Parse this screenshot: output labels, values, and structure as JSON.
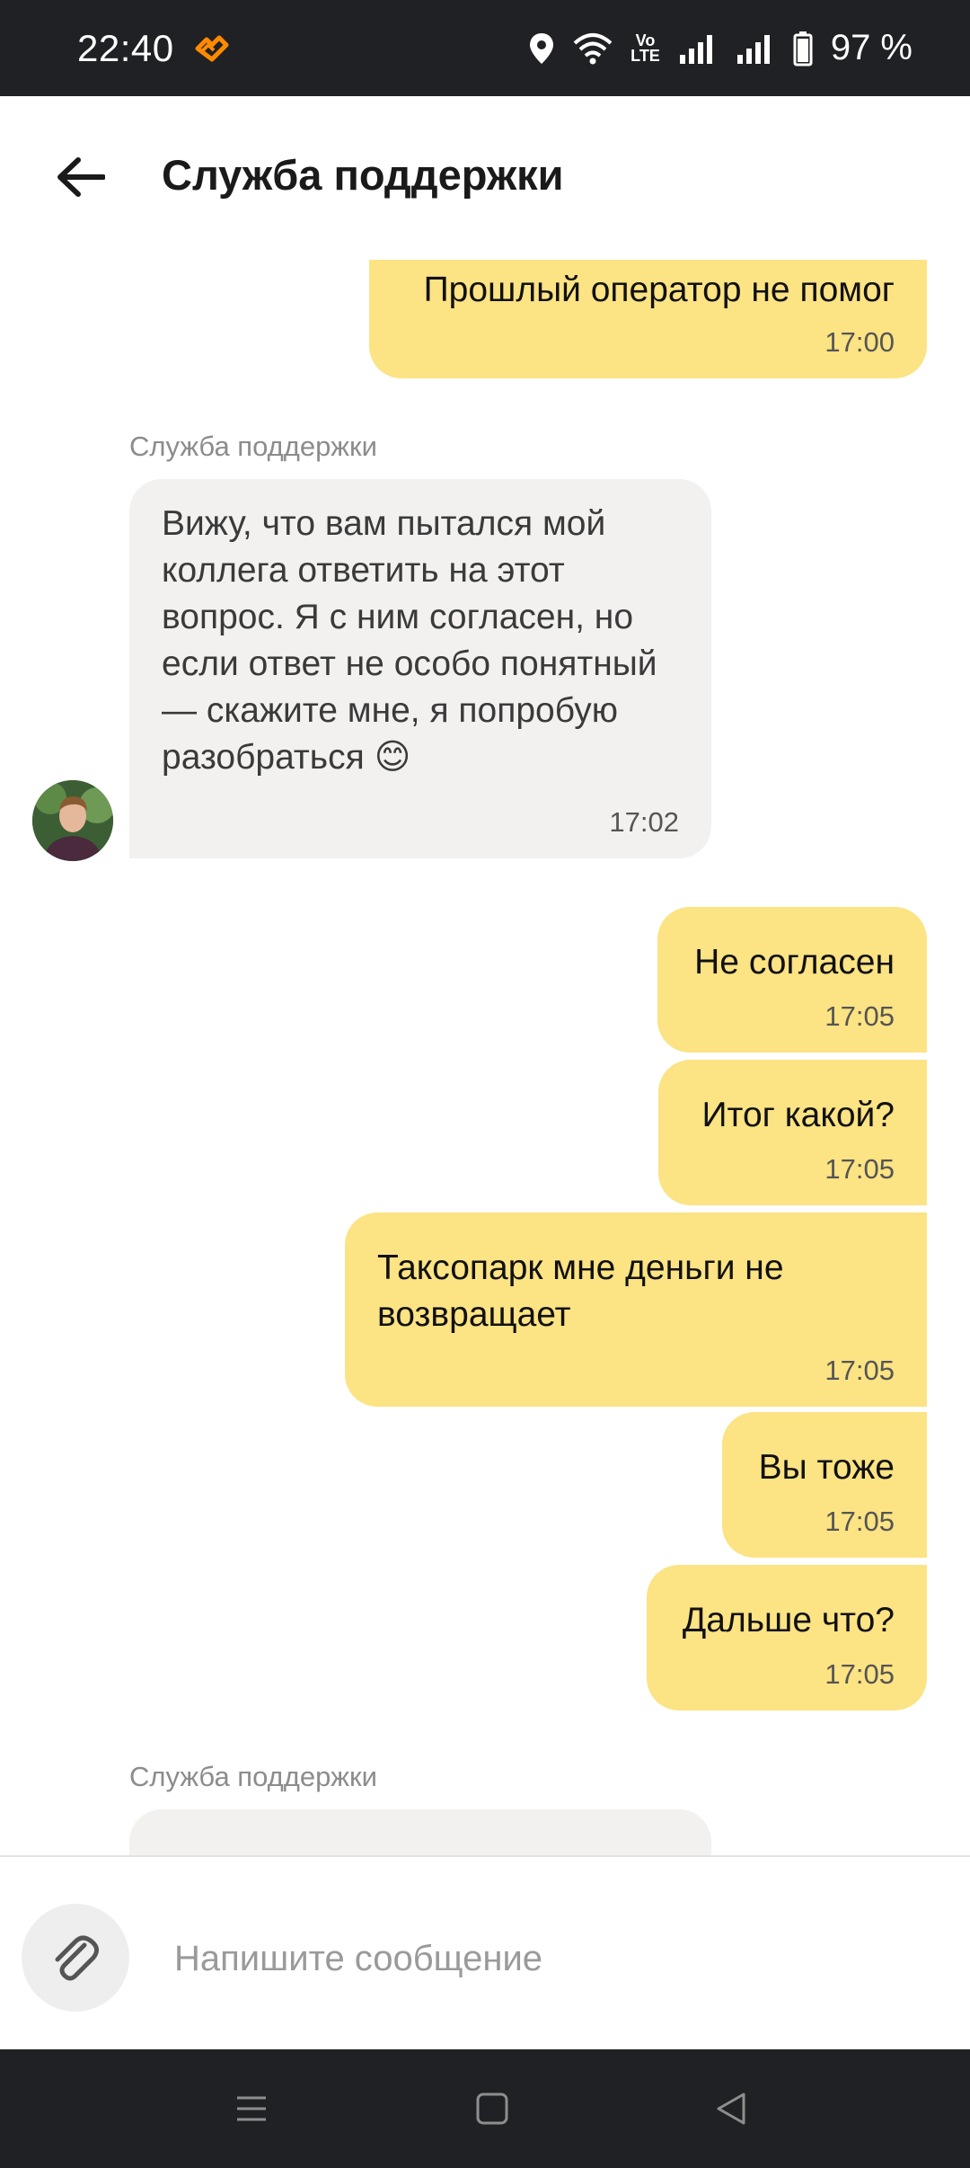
{
  "status_bar": {
    "time": "22:40",
    "battery": "97 %",
    "icons": [
      "activity-icon",
      "location-icon",
      "wifi-icon",
      "volte-icon",
      "signal-icon",
      "signal-icon",
      "battery-icon"
    ],
    "volte_line1": "Vo",
    "volte_line2": "LTE"
  },
  "header": {
    "title": "Служба поддержки",
    "back_icon": "arrow-left-icon"
  },
  "chat": {
    "sender_label": "Служба поддержки",
    "messages": [
      {
        "direction": "out",
        "text": "Прошлый оператор не помог",
        "time": "17:00"
      },
      {
        "direction": "in",
        "text": "Вижу, что вам пытался мой коллега ответить на этот вопрос. Я с ним согласен, но если ответ не особо понятный — скажите мне, я попробую разобраться 😊",
        "time": "17:02"
      },
      {
        "direction": "out",
        "text": "Не согласен",
        "time": "17:05"
      },
      {
        "direction": "out",
        "text": "Итог какой?",
        "time": "17:05"
      },
      {
        "direction": "out",
        "text": "Таксопарк мне деньги не возвращает",
        "time": "17:05"
      },
      {
        "direction": "out",
        "text": "Вы тоже",
        "time": "17:05"
      },
      {
        "direction": "out",
        "text": "Дальше что?",
        "time": "17:05"
      }
    ]
  },
  "composer": {
    "placeholder": "Напишите сообщение",
    "value": "",
    "attach_icon": "paperclip-icon"
  },
  "nav_bar": {
    "icons": [
      "menu-icon",
      "home-icon",
      "back-icon"
    ]
  },
  "colors": {
    "outgoing_bubble": "#fce383",
    "incoming_bubble": "#f2f1ef",
    "system_bar": "#202124",
    "accent_notification": "#ff8a00"
  }
}
